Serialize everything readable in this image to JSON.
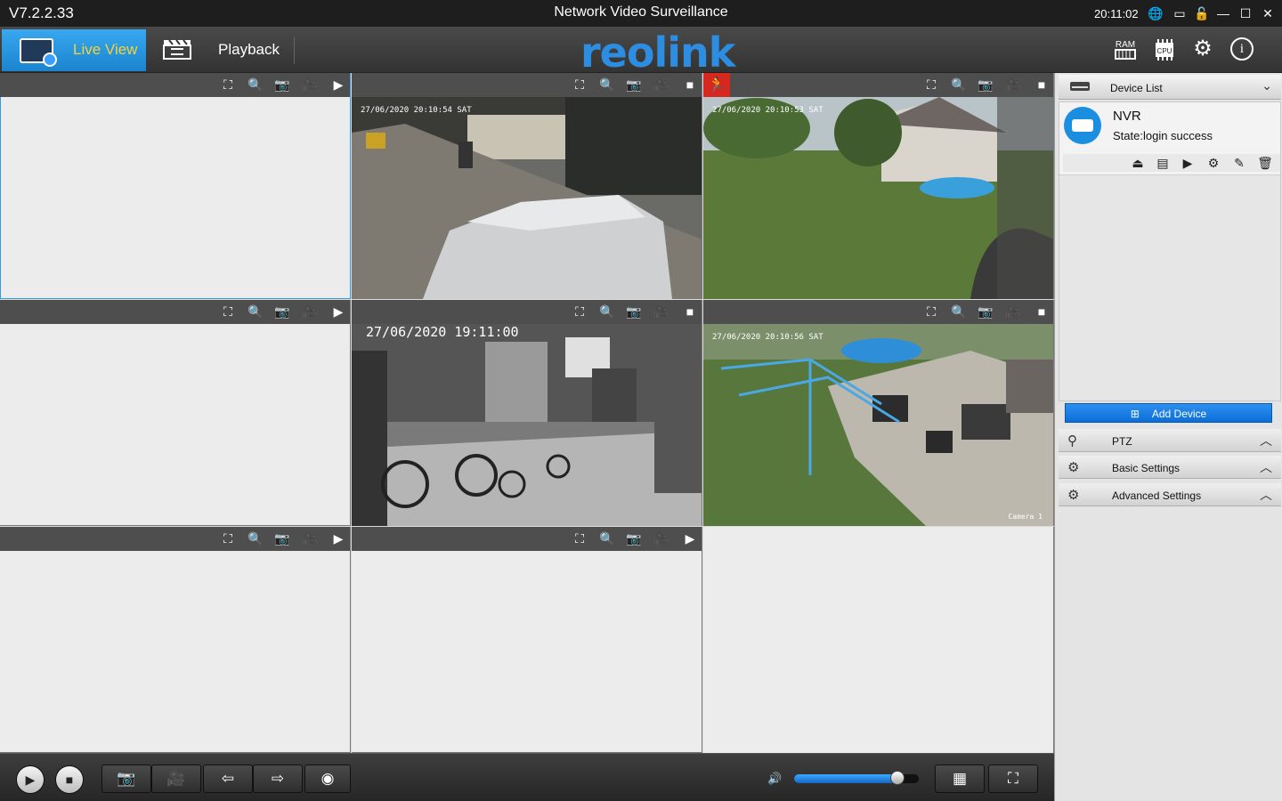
{
  "window": {
    "version": "V7.2.2.33",
    "title": "Network Video Surveillance",
    "clock": "20:11:02"
  },
  "toolbar": {
    "live_view": "Live View",
    "playback": "Playback",
    "logo": "reolink"
  },
  "cells": [
    {
      "osd": "",
      "has_video": false
    },
    {
      "osd": "27/06/2020 20:10:54 SAT",
      "has_video": true,
      "scene": "driveway"
    },
    {
      "osd": "27/06/2020 20:10:53 SAT",
      "has_video": true,
      "scene": "garden",
      "motion": true
    },
    {
      "osd": "",
      "has_video": false
    },
    {
      "osd": "27/06/2020 19:11:00",
      "has_video": true,
      "scene": "garage"
    },
    {
      "osd": "27/06/2020 20:10:56 SAT",
      "has_video": true,
      "scene": "patio",
      "camera_label": "Camera 1"
    },
    {
      "osd": "",
      "has_video": false
    },
    {
      "osd": "",
      "has_video": false
    }
  ],
  "side": {
    "device_list": "Device List",
    "device": {
      "name": "NVR",
      "state": "State:login success"
    },
    "add_device": "Add Device",
    "sections": [
      {
        "label": "PTZ",
        "icon": "ptz-icon"
      },
      {
        "label": "Basic Settings",
        "icon": "camera-settings-icon"
      },
      {
        "label": "Advanced Settings",
        "icon": "camera-settings-icon"
      }
    ]
  },
  "bottom": {
    "volume": 0.83
  }
}
